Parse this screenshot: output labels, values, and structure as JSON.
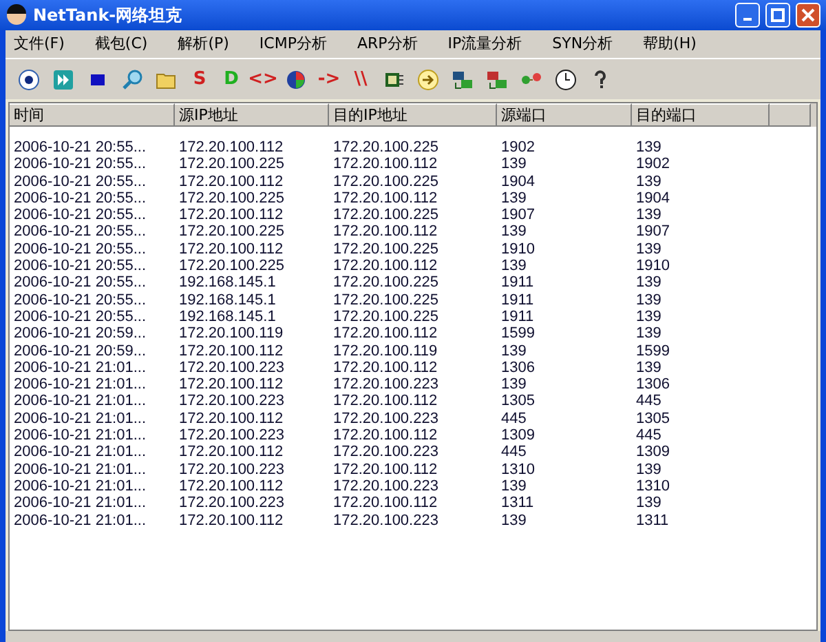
{
  "window": {
    "title": "NetTank-网络坦克"
  },
  "menu": [
    {
      "label": "文件(F)"
    },
    {
      "label": "截包(C)"
    },
    {
      "label": "解析(P)"
    },
    {
      "label": "ICMP分析"
    },
    {
      "label": "ARP分析"
    },
    {
      "label": "IP流量分析"
    },
    {
      "label": "SYN分析"
    },
    {
      "label": "帮助(H)"
    }
  ],
  "toolbar": [
    {
      "kind": "icon"
    },
    {
      "kind": "icon"
    },
    {
      "kind": "icon"
    },
    {
      "kind": "icon"
    },
    {
      "kind": "icon"
    },
    {
      "kind": "glyph",
      "label": "S",
      "color": "#d02020"
    },
    {
      "kind": "glyph",
      "label": "D",
      "color": "#20b020"
    },
    {
      "kind": "glyph",
      "label": "<>",
      "color": "#d02020"
    },
    {
      "kind": "icon"
    },
    {
      "kind": "glyph",
      "label": "->",
      "color": "#d02020"
    },
    {
      "kind": "glyph",
      "label": "\\\\",
      "color": "#d02020"
    },
    {
      "kind": "icon"
    },
    {
      "kind": "icon"
    },
    {
      "kind": "icon"
    },
    {
      "kind": "icon"
    },
    {
      "kind": "icon"
    },
    {
      "kind": "icon"
    },
    {
      "kind": "icon"
    }
  ],
  "table": {
    "columns": [
      "时间",
      "源IP地址",
      "目的IP地址",
      "源端口",
      "目的端口"
    ],
    "rows": [
      [
        "2006-10-21 20:55...",
        "172.20.100.112",
        "172.20.100.225",
        "1902",
        "139"
      ],
      [
        "2006-10-21 20:55...",
        "172.20.100.225",
        "172.20.100.112",
        "139",
        "1902"
      ],
      [
        "2006-10-21 20:55...",
        "172.20.100.112",
        "172.20.100.225",
        "1904",
        "139"
      ],
      [
        "2006-10-21 20:55...",
        "172.20.100.225",
        "172.20.100.112",
        "139",
        "1904"
      ],
      [
        "2006-10-21 20:55...",
        "172.20.100.112",
        "172.20.100.225",
        "1907",
        "139"
      ],
      [
        "2006-10-21 20:55...",
        "172.20.100.225",
        "172.20.100.112",
        "139",
        "1907"
      ],
      [
        "2006-10-21 20:55...",
        "172.20.100.112",
        "172.20.100.225",
        "1910",
        "139"
      ],
      [
        "2006-10-21 20:55...",
        "172.20.100.225",
        "172.20.100.112",
        "139",
        "1910"
      ],
      [
        "2006-10-21 20:55...",
        "192.168.145.1",
        "172.20.100.225",
        "1911",
        "139"
      ],
      [
        "2006-10-21 20:55...",
        "192.168.145.1",
        "172.20.100.225",
        "1911",
        "139"
      ],
      [
        "2006-10-21 20:55...",
        "192.168.145.1",
        "172.20.100.225",
        "1911",
        "139"
      ],
      [
        "2006-10-21 20:59...",
        "172.20.100.119",
        "172.20.100.112",
        "1599",
        "139"
      ],
      [
        "2006-10-21 20:59...",
        "172.20.100.112",
        "172.20.100.119",
        "139",
        "1599"
      ],
      [
        "2006-10-21 21:01...",
        "172.20.100.223",
        "172.20.100.112",
        "1306",
        "139"
      ],
      [
        "2006-10-21 21:01...",
        "172.20.100.112",
        "172.20.100.223",
        "139",
        "1306"
      ],
      [
        "2006-10-21 21:01...",
        "172.20.100.223",
        "172.20.100.112",
        "1305",
        "445"
      ],
      [
        "2006-10-21 21:01...",
        "172.20.100.112",
        "172.20.100.223",
        "445",
        "1305"
      ],
      [
        "2006-10-21 21:01...",
        "172.20.100.223",
        "172.20.100.112",
        "1309",
        "445"
      ],
      [
        "2006-10-21 21:01...",
        "172.20.100.112",
        "172.20.100.223",
        "445",
        "1309"
      ],
      [
        "2006-10-21 21:01...",
        "172.20.100.223",
        "172.20.100.112",
        "1310",
        "139"
      ],
      [
        "2006-10-21 21:01...",
        "172.20.100.112",
        "172.20.100.223",
        "139",
        "1310"
      ],
      [
        "2006-10-21 21:01...",
        "172.20.100.223",
        "172.20.100.112",
        "1311",
        "139"
      ],
      [
        "2006-10-21 21:01...",
        "172.20.100.112",
        "172.20.100.223",
        "139",
        "1311"
      ]
    ]
  }
}
